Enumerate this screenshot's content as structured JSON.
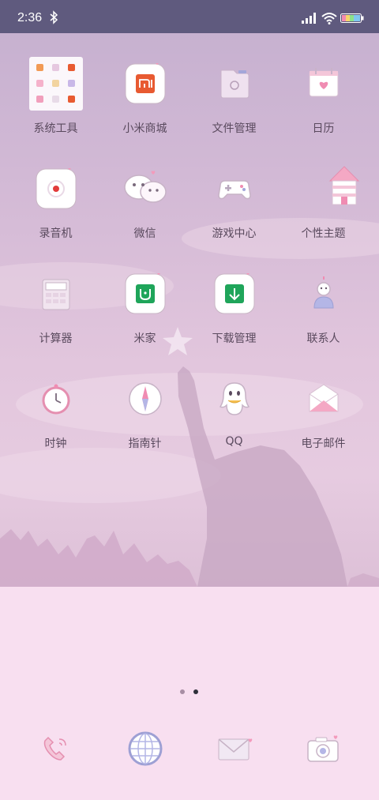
{
  "status_bar": {
    "time": "2:36",
    "icons": [
      "bluetooth-icon",
      "signal-icon",
      "wifi-icon",
      "battery-icon"
    ]
  },
  "home": {
    "apps": [
      {
        "label": "系统工具",
        "icon": "system-tools-folder-icon"
      },
      {
        "label": "小米商城",
        "icon": "mi-store-icon"
      },
      {
        "label": "文件管理",
        "icon": "file-manager-icon"
      },
      {
        "label": "日历",
        "icon": "calendar-icon"
      },
      {
        "label": "录音机",
        "icon": "recorder-icon"
      },
      {
        "label": "微信",
        "icon": "wechat-icon"
      },
      {
        "label": "游戏中心",
        "icon": "game-center-icon"
      },
      {
        "label": "个性主题",
        "icon": "themes-icon"
      },
      {
        "label": "计算器",
        "icon": "calculator-icon"
      },
      {
        "label": "米家",
        "icon": "mi-home-icon"
      },
      {
        "label": "下载管理",
        "icon": "downloads-icon"
      },
      {
        "label": "联系人",
        "icon": "contacts-icon"
      },
      {
        "label": "时钟",
        "icon": "clock-icon"
      },
      {
        "label": "指南针",
        "icon": "compass-icon"
      },
      {
        "label": "QQ",
        "icon": "qq-icon"
      },
      {
        "label": "电子邮件",
        "icon": "email-icon"
      }
    ],
    "pages": {
      "count": 2,
      "current": 2
    }
  },
  "dock": [
    {
      "icon": "phone-icon"
    },
    {
      "icon": "browser-icon"
    },
    {
      "icon": "messages-icon"
    },
    {
      "icon": "camera-icon"
    }
  ],
  "colors": {
    "status_bar": "#5f5a7e",
    "wallpaper": "#d8bfd8",
    "lower_background": "#f8dff0",
    "label_text": "#5a4a5e",
    "mi_orange": "#e85a31",
    "mi_green": "#1fa55a"
  }
}
